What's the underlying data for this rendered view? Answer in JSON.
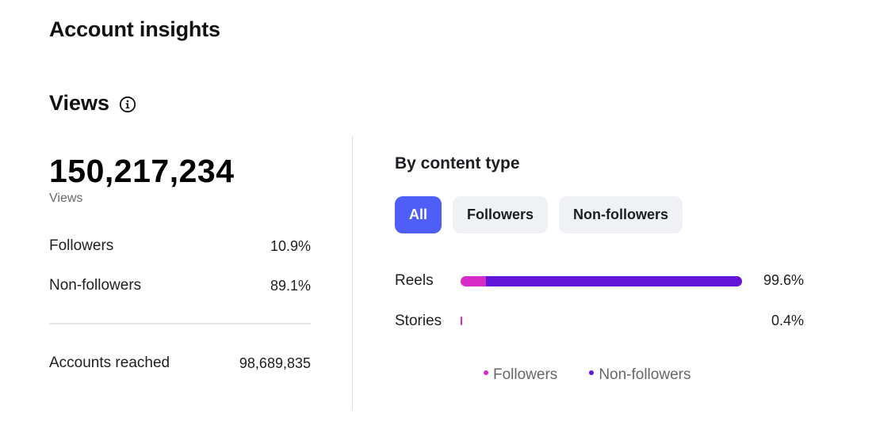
{
  "page": {
    "title": "Account insights"
  },
  "views": {
    "title": "Views",
    "icon": "info-icon",
    "total": "150,217,234",
    "total_caption": "Views",
    "followers_label": "Followers",
    "followers_value": "10.9%",
    "nonfollowers_label": "Non-followers",
    "nonfollowers_value": "89.1%",
    "accounts_reached_label": "Accounts reached",
    "accounts_reached_value": "98,689,835"
  },
  "by_content_type": {
    "title": "By content type",
    "filters": [
      {
        "label": "All",
        "selected": true
      },
      {
        "label": "Followers",
        "selected": false
      },
      {
        "label": "Non-followers",
        "selected": false
      }
    ],
    "rows": [
      {
        "label": "Reels",
        "value": "99.6%",
        "fraction": 0.996,
        "followers_share": 0.09,
        "nonfollowers_share": 0.91
      },
      {
        "label": "Stories",
        "value": "0.4%",
        "fraction": 0.004,
        "followers_share": 1.0,
        "nonfollowers_share": 0.0
      }
    ],
    "legend": [
      {
        "label": "Followers",
        "color": "#d62bc7"
      },
      {
        "label": "Non-followers",
        "color": "#6115d8"
      }
    ]
  },
  "colors": {
    "accent": "#4f5ef7",
    "followers": "#d62bc7",
    "nonfollowers": "#6115d8"
  }
}
